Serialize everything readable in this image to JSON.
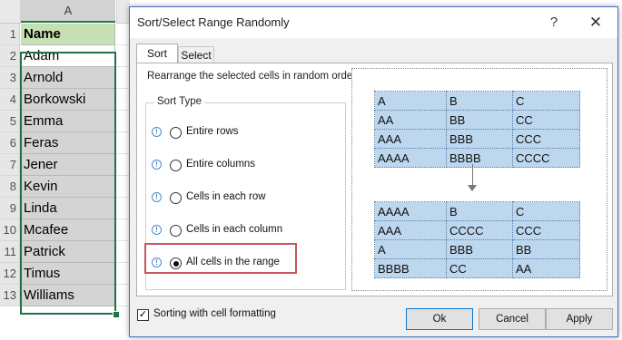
{
  "sheet": {
    "column_header": "A",
    "rows": [
      {
        "num": "1",
        "value": "Name"
      },
      {
        "num": "2",
        "value": "Adam"
      },
      {
        "num": "3",
        "value": "Arnold"
      },
      {
        "num": "4",
        "value": "Borkowski"
      },
      {
        "num": "5",
        "value": "Emma"
      },
      {
        "num": "6",
        "value": "Feras"
      },
      {
        "num": "7",
        "value": "Jener"
      },
      {
        "num": "8",
        "value": "Kevin"
      },
      {
        "num": "9",
        "value": "Linda"
      },
      {
        "num": "10",
        "value": "Mcafee"
      },
      {
        "num": "11",
        "value": "Patrick"
      },
      {
        "num": "12",
        "value": "Timus"
      },
      {
        "num": "13",
        "value": "Williams"
      }
    ]
  },
  "dialog": {
    "title": "Sort/Select Range Randomly",
    "help": "?",
    "close": "✕",
    "tabs": {
      "sort": "Sort",
      "select": "Select"
    },
    "description": "Rearrange the selected cells in random order",
    "sort_type_label": "Sort Type",
    "options": [
      {
        "label": "Entire rows",
        "selected": false
      },
      {
        "label": "Entire columns",
        "selected": false
      },
      {
        "label": "Cells in each row",
        "selected": false
      },
      {
        "label": "Cells in each column",
        "selected": false
      },
      {
        "label": "All cells in the range",
        "selected": true
      }
    ],
    "preview_before": [
      [
        "A",
        "B",
        "C"
      ],
      [
        "AA",
        "BB",
        "CC"
      ],
      [
        "AAA",
        "BBB",
        "CCC"
      ],
      [
        "AAAA",
        "BBBB",
        "CCCC"
      ]
    ],
    "preview_after": [
      [
        "AAAA",
        "B",
        "C"
      ],
      [
        "AAA",
        "CCCC",
        "CCC"
      ],
      [
        "A",
        "BBB",
        "BB"
      ],
      [
        "BBBB",
        "CC",
        "AA"
      ]
    ],
    "checkbox": {
      "label": "Sorting with cell formatting",
      "checked": true,
      "mark": "✓"
    },
    "buttons": {
      "ok": "Ok",
      "cancel": "Cancel",
      "apply": "Apply"
    }
  },
  "colors": {
    "header_green": "#c6e0b4",
    "excel_green": "#217346",
    "preview_blue": "#bdd7ee",
    "highlight_red": "#c8575d"
  }
}
